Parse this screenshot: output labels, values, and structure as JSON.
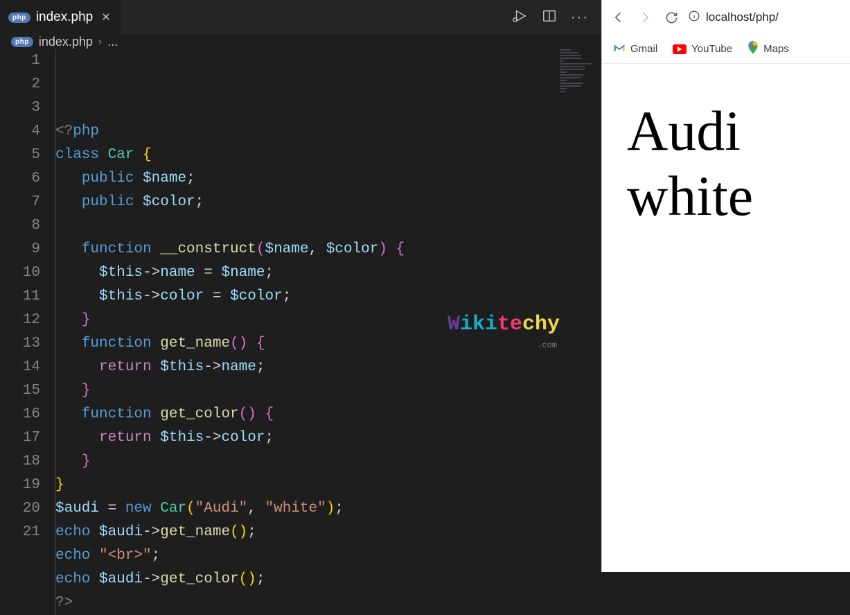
{
  "editor": {
    "tab": {
      "filename": "index.php"
    },
    "breadcrumb": {
      "filename": "index.php",
      "separator": "›",
      "rest": "..."
    },
    "line_numbers": [
      "1",
      "2",
      "3",
      "4",
      "5",
      "6",
      "7",
      "8",
      "9",
      "10",
      "11",
      "12",
      "13",
      "14",
      "15",
      "16",
      "17",
      "18",
      "19",
      "20",
      "21"
    ],
    "code_tokens": [
      [
        [
          "tk-gray",
          "<?"
        ],
        [
          "tk-blue",
          "php"
        ]
      ],
      [
        [
          "tk-blue",
          "class "
        ],
        [
          "tk-type",
          "Car "
        ],
        [
          "tk-brace",
          "{"
        ]
      ],
      [
        [
          "tk-white",
          "   "
        ],
        [
          "tk-blue",
          "public "
        ],
        [
          "tk-var",
          "$name"
        ],
        [
          "tk-white",
          ";"
        ]
      ],
      [
        [
          "tk-white",
          "   "
        ],
        [
          "tk-blue",
          "public "
        ],
        [
          "tk-var",
          "$color"
        ],
        [
          "tk-white",
          ";"
        ]
      ],
      [
        [
          "",
          ""
        ]
      ],
      [
        [
          "tk-white",
          "   "
        ],
        [
          "tk-blue",
          "function "
        ],
        [
          "tk-func",
          "__construct"
        ],
        [
          "tk-brace2",
          "("
        ],
        [
          "tk-var",
          "$name"
        ],
        [
          "tk-white",
          ", "
        ],
        [
          "tk-var",
          "$color"
        ],
        [
          "tk-brace2",
          ") {"
        ]
      ],
      [
        [
          "tk-white",
          "     "
        ],
        [
          "tk-var",
          "$this"
        ],
        [
          "tk-white",
          "->"
        ],
        [
          "tk-var",
          "name"
        ],
        [
          "tk-white",
          " = "
        ],
        [
          "tk-var",
          "$name"
        ],
        [
          "tk-white",
          ";"
        ]
      ],
      [
        [
          "tk-white",
          "     "
        ],
        [
          "tk-var",
          "$this"
        ],
        [
          "tk-white",
          "->"
        ],
        [
          "tk-var",
          "color"
        ],
        [
          "tk-white",
          " = "
        ],
        [
          "tk-var",
          "$color"
        ],
        [
          "tk-white",
          ";"
        ]
      ],
      [
        [
          "tk-white",
          "   "
        ],
        [
          "tk-brace2",
          "}"
        ]
      ],
      [
        [
          "tk-white",
          "   "
        ],
        [
          "tk-blue",
          "function "
        ],
        [
          "tk-func",
          "get_name"
        ],
        [
          "tk-brace2",
          "() {"
        ]
      ],
      [
        [
          "tk-white",
          "     "
        ],
        [
          "tk-ctrl",
          "return "
        ],
        [
          "tk-var",
          "$this"
        ],
        [
          "tk-white",
          "->"
        ],
        [
          "tk-var",
          "name"
        ],
        [
          "tk-white",
          ";"
        ]
      ],
      [
        [
          "tk-white",
          "   "
        ],
        [
          "tk-brace2",
          "}"
        ]
      ],
      [
        [
          "tk-white",
          "   "
        ],
        [
          "tk-blue",
          "function "
        ],
        [
          "tk-func",
          "get_color"
        ],
        [
          "tk-brace2",
          "() {"
        ]
      ],
      [
        [
          "tk-white",
          "     "
        ],
        [
          "tk-ctrl",
          "return "
        ],
        [
          "tk-var",
          "$this"
        ],
        [
          "tk-white",
          "->"
        ],
        [
          "tk-var",
          "color"
        ],
        [
          "tk-white",
          ";"
        ]
      ],
      [
        [
          "tk-white",
          "   "
        ],
        [
          "tk-brace2",
          "}"
        ]
      ],
      [
        [
          "tk-brace",
          "}"
        ]
      ],
      [
        [
          "tk-var",
          "$audi"
        ],
        [
          "tk-white",
          " = "
        ],
        [
          "tk-blue",
          "new "
        ],
        [
          "tk-type",
          "Car"
        ],
        [
          "tk-brace",
          "("
        ],
        [
          "tk-str",
          "\"Audi\""
        ],
        [
          "tk-white",
          ", "
        ],
        [
          "tk-str",
          "\"white\""
        ],
        [
          "tk-brace",
          ")"
        ],
        [
          "tk-white",
          ";"
        ]
      ],
      [
        [
          "tk-blue",
          "echo "
        ],
        [
          "tk-var",
          "$audi"
        ],
        [
          "tk-white",
          "->"
        ],
        [
          "tk-func",
          "get_name"
        ],
        [
          "tk-brace",
          "()"
        ],
        [
          "tk-white",
          ";"
        ]
      ],
      [
        [
          "tk-blue",
          "echo "
        ],
        [
          "tk-str",
          "\"<br>\""
        ],
        [
          "tk-white",
          ";"
        ]
      ],
      [
        [
          "tk-blue",
          "echo "
        ],
        [
          "tk-var",
          "$audi"
        ],
        [
          "tk-white",
          "->"
        ],
        [
          "tk-func",
          "get_color"
        ],
        [
          "tk-brace",
          "()"
        ],
        [
          "tk-white",
          ";"
        ]
      ],
      [
        [
          "tk-gray",
          "?>"
        ]
      ]
    ],
    "watermark": {
      "part1": "W",
      "part2": "iki",
      "part3": "te",
      "part4": "chy",
      "suffix": ".com"
    }
  },
  "browser": {
    "url": "localhost/php/",
    "bookmarks": {
      "gmail": "Gmail",
      "youtube": "YouTube",
      "maps": "Maps"
    },
    "output": {
      "line1": "Audi",
      "line2": "white"
    }
  }
}
